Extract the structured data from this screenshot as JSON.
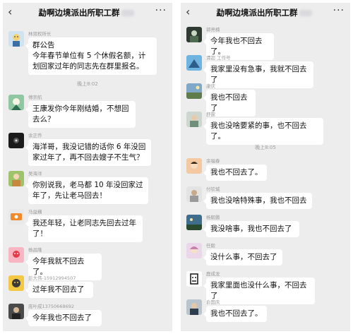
{
  "left": {
    "title": "勐啊边境派出所职工群",
    "time1": "晚上8:02",
    "messages": [
      {
        "sender": "林双权所长",
        "lines": [
          "群公告",
          "今年春节单位有 5 个休假名额，计",
          "划回家过年的同志先在群里报名。"
        ]
      },
      {
        "sender": "傅崇航",
        "lines": [
          "王康发你今年刚结婚，不想回",
          "去么？"
        ]
      },
      {
        "sender": "余正乔",
        "lines": [
          "海洋哥，我没记错的话你 6 年没回",
          "家过年了，再不回去嫂子不生气？"
        ]
      },
      {
        "sender": "吴海洋",
        "lines": [
          "你别说我，老马都 10 年没回家过",
          "年了，先让老马回去！"
        ]
      },
      {
        "sender": "马益巍",
        "lines": [
          "我还年轻，让老同志先回去过年",
          "了！"
        ]
      },
      {
        "sender": "杨昌隆",
        "lines": [
          "今年我就不回去了。"
        ]
      },
      {
        "sender": "彭大伟-15912994507",
        "lines": [
          "过年我不回去了"
        ]
      },
      {
        "sender": "庞叶成13750668692",
        "lines": [
          "今年我也不回去了"
        ]
      }
    ]
  },
  "right": {
    "title": "勐啊边境派出所职工群",
    "time1": "晚上8:05",
    "messages": [
      {
        "sender": "郭亮楠",
        "lines": [
          "今年我也不回去了。"
        ]
      },
      {
        "sender": "谭超 工作号",
        "lines": [
          "我家里没有急事，我就不回去了"
        ]
      },
      {
        "sender": "康庆",
        "lines": [
          "我也不回去了"
        ]
      },
      {
        "sender": "舒霆",
        "lines": [
          "我也没啥要紧的事，也不回去了。"
        ]
      },
      {
        "sender": "余福春",
        "lines": [
          "我也不回去了。"
        ]
      },
      {
        "sender": "付钦城",
        "lines": [
          "我也没啥特殊事，我也不回去"
        ]
      },
      {
        "sender": "杨毅鹏",
        "lines": [
          "我没啥事，我也不回去了"
        ]
      },
      {
        "sender": "任毅",
        "lines": [
          "没什么事，不回去了"
        ]
      },
      {
        "sender": "鹿成龙",
        "lines": [
          "我家里面也没什么事，不回去了"
        ]
      },
      {
        "sender": "俞国庆",
        "lines": [
          "我也不回去了。"
        ]
      }
    ]
  },
  "icons": {
    "back": "‹",
    "more": "···"
  },
  "colors": {
    "chat_bg": "#ededed",
    "bubble": "#ffffff",
    "meta": "#9a9a9a"
  }
}
